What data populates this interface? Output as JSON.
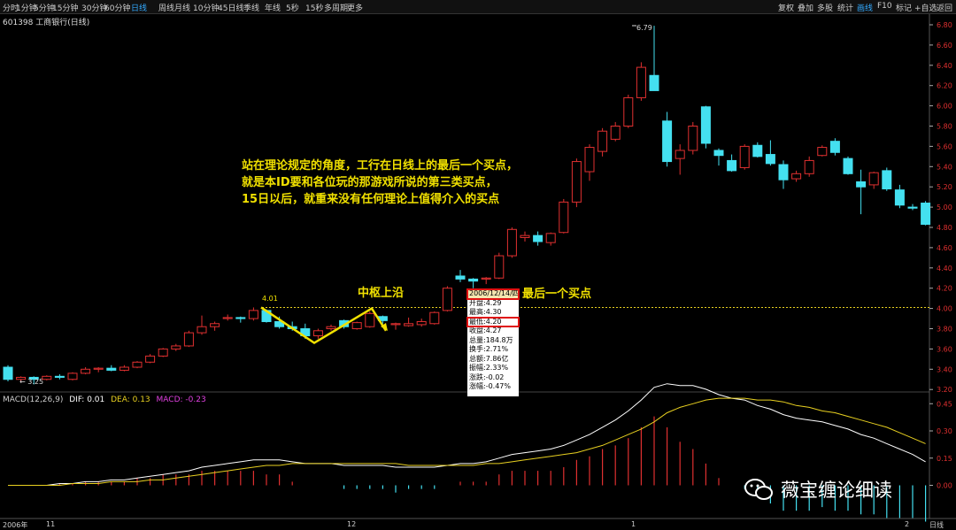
{
  "toolbar": {
    "tabs": [
      "分时",
      "1分钟",
      "5分钟",
      "15分钟",
      "30分钟",
      "60分钟",
      "日线",
      "周线",
      "月线",
      "10分钟",
      "45日线",
      "季线",
      "年线",
      "5秒",
      "15秒",
      "多周期",
      "更多"
    ],
    "active_tab": "日线",
    "right_buttons": [
      "复权",
      "叠加",
      "多股",
      "统计",
      "画线",
      "F10",
      "标记",
      "+自选",
      "返回"
    ],
    "active_right": "画线"
  },
  "stock_title": "601398 工商银行(日线)",
  "macd_header": {
    "label": "MACD(12,26,9)",
    "dif": "DIF: 0.01",
    "dea": "DEA: 0.13",
    "macd": "MACD: -0.23"
  },
  "x_labels": {
    "year": "2006年",
    "m11": "11",
    "m12": "12",
    "m1": "1",
    "m2": "2",
    "period": "日线"
  },
  "annotations": {
    "main_text": [
      "站在理论规定的角度，工行在日线上的最后一个买点，",
      "就是本ID要和各位玩的那游戏所说的第三类买点，",
      "15日以后，就重来没有任何理论上值得介入的买点"
    ],
    "center_top": "中枢上沿",
    "last_buy": "最后一个买点",
    "high_label": "6.79",
    "low_label": "3.25",
    "pivot_label": "4.01"
  },
  "tooltip": {
    "date": "2006/12/14/四",
    "rows": [
      "开盘:4.29",
      "最高:4.30",
      "最低:4.20",
      "收盘:4.27",
      "总量:184.8万",
      "换手:2.71%",
      "总额:7.86亿",
      "振幅:2.33%",
      "涨跌:-0.02",
      "涨幅:-0.47%"
    ]
  },
  "watermark": "薇宝缠论细读",
  "colors": {
    "up": "#e03030",
    "down": "#44e0f0",
    "dif": "#ffffff",
    "dea": "#e8d020",
    "accent": "#f0e000",
    "tab_active": "#3399ff"
  },
  "chart_data": [
    {
      "type": "candlestick",
      "title": "601398 工商银行(日线)",
      "y_ticks": [
        3.2,
        3.4,
        3.6,
        3.8,
        4.0,
        4.2,
        4.4,
        4.6,
        4.8,
        5.0,
        5.2,
        5.4,
        5.6,
        5.8,
        6.0,
        6.2,
        6.4,
        6.6,
        6.8
      ],
      "ylim": [
        3.17,
        6.87
      ],
      "reference_line": 4.01,
      "candles": [
        [
          3.42,
          3.44,
          3.28,
          3.3
        ],
        [
          3.3,
          3.33,
          3.27,
          3.32
        ],
        [
          3.32,
          3.33,
          3.25,
          3.3
        ],
        [
          3.3,
          3.34,
          3.29,
          3.33
        ],
        [
          3.33,
          3.35,
          3.3,
          3.32
        ],
        [
          3.3,
          3.37,
          3.29,
          3.36
        ],
        [
          3.36,
          3.42,
          3.35,
          3.4
        ],
        [
          3.4,
          3.42,
          3.37,
          3.41
        ],
        [
          3.41,
          3.44,
          3.38,
          3.39
        ],
        [
          3.39,
          3.44,
          3.38,
          3.42
        ],
        [
          3.42,
          3.48,
          3.41,
          3.47
        ],
        [
          3.47,
          3.55,
          3.46,
          3.53
        ],
        [
          3.53,
          3.61,
          3.52,
          3.6
        ],
        [
          3.6,
          3.65,
          3.58,
          3.63
        ],
        [
          3.63,
          3.78,
          3.62,
          3.76
        ],
        [
          3.76,
          3.93,
          3.74,
          3.82
        ],
        [
          3.82,
          3.87,
          3.78,
          3.85
        ],
        [
          3.9,
          3.94,
          3.88,
          3.91
        ],
        [
          3.91,
          3.92,
          3.86,
          3.9
        ],
        [
          3.9,
          4.01,
          3.88,
          3.98
        ],
        [
          3.98,
          3.99,
          3.86,
          3.87
        ],
        [
          3.87,
          3.92,
          3.8,
          3.82
        ],
        [
          3.82,
          3.87,
          3.78,
          3.8
        ],
        [
          3.8,
          3.85,
          3.7,
          3.73
        ],
        [
          3.73,
          3.8,
          3.7,
          3.78
        ],
        [
          3.8,
          3.84,
          3.78,
          3.82
        ],
        [
          3.88,
          3.89,
          3.8,
          3.82
        ],
        [
          3.8,
          3.87,
          3.79,
          3.86
        ],
        [
          3.82,
          3.97,
          3.81,
          3.95
        ],
        [
          3.92,
          3.93,
          3.85,
          3.88
        ],
        [
          3.84,
          3.86,
          3.79,
          3.85
        ],
        [
          3.83,
          3.91,
          3.82,
          3.85
        ],
        [
          3.84,
          3.9,
          3.82,
          3.87
        ],
        [
          3.85,
          3.97,
          3.84,
          3.96
        ],
        [
          3.98,
          4.22,
          3.97,
          4.2
        ],
        [
          4.32,
          4.38,
          4.26,
          4.29
        ],
        [
          4.29,
          4.3,
          4.2,
          4.27
        ],
        [
          4.29,
          4.31,
          4.24,
          4.3
        ],
        [
          4.3,
          4.55,
          4.29,
          4.52
        ],
        [
          4.52,
          4.8,
          4.5,
          4.78
        ],
        [
          4.7,
          4.76,
          4.66,
          4.72
        ],
        [
          4.72,
          4.76,
          4.62,
          4.66
        ],
        [
          4.65,
          4.75,
          4.62,
          4.74
        ],
        [
          4.75,
          5.08,
          4.74,
          5.05
        ],
        [
          5.05,
          5.48,
          5.0,
          5.45
        ],
        [
          5.35,
          5.62,
          5.26,
          5.59
        ],
        [
          5.55,
          5.78,
          5.5,
          5.75
        ],
        [
          5.67,
          5.84,
          5.65,
          5.8
        ],
        [
          5.8,
          6.11,
          5.78,
          6.08
        ],
        [
          6.08,
          6.43,
          6.05,
          6.38
        ],
        [
          6.3,
          6.79,
          6.15,
          6.15
        ],
        [
          5.85,
          5.94,
          5.4,
          5.45
        ],
        [
          5.48,
          5.62,
          5.32,
          5.56
        ],
        [
          5.56,
          5.84,
          5.52,
          5.8
        ],
        [
          5.99,
          6.0,
          5.58,
          5.63
        ],
        [
          5.56,
          5.58,
          5.41,
          5.51
        ],
        [
          5.46,
          5.52,
          5.35,
          5.36
        ],
        [
          5.39,
          5.62,
          5.37,
          5.6
        ],
        [
          5.61,
          5.64,
          5.49,
          5.5
        ],
        [
          5.52,
          5.66,
          5.41,
          5.43
        ],
        [
          5.42,
          5.46,
          5.18,
          5.27
        ],
        [
          5.28,
          5.36,
          5.25,
          5.33
        ],
        [
          5.33,
          5.5,
          5.3,
          5.46
        ],
        [
          5.51,
          5.61,
          5.5,
          5.59
        ],
        [
          5.65,
          5.68,
          5.51,
          5.54
        ],
        [
          5.48,
          5.5,
          5.32,
          5.33
        ],
        [
          5.25,
          5.37,
          4.93,
          5.2
        ],
        [
          5.22,
          5.35,
          5.18,
          5.34
        ],
        [
          5.36,
          5.39,
          5.16,
          5.18
        ],
        [
          5.17,
          5.22,
          4.99,
          5.02
        ],
        [
          5.0,
          5.03,
          4.97,
          4.99
        ],
        [
          5.04,
          5.06,
          4.82,
          4.83
        ]
      ]
    },
    {
      "type": "macd",
      "y_ticks": [
        0.0,
        0.15,
        0.3,
        0.45
      ],
      "ylim": [
        -0.2,
        0.64
      ],
      "series": [
        {
          "name": "DIF",
          "values": [
            0.0,
            0.0,
            0.0,
            0.0,
            0.01,
            0.01,
            0.02,
            0.02,
            0.03,
            0.03,
            0.04,
            0.05,
            0.06,
            0.07,
            0.08,
            0.1,
            0.11,
            0.12,
            0.13,
            0.14,
            0.14,
            0.14,
            0.13,
            0.12,
            0.12,
            0.12,
            0.11,
            0.11,
            0.11,
            0.11,
            0.1,
            0.1,
            0.1,
            0.1,
            0.11,
            0.12,
            0.12,
            0.13,
            0.15,
            0.17,
            0.18,
            0.19,
            0.2,
            0.22,
            0.25,
            0.28,
            0.32,
            0.36,
            0.41,
            0.47,
            0.54,
            0.56,
            0.55,
            0.55,
            0.53,
            0.5,
            0.48,
            0.47,
            0.44,
            0.42,
            0.39,
            0.37,
            0.36,
            0.35,
            0.33,
            0.31,
            0.28,
            0.26,
            0.23,
            0.2,
            0.17,
            0.13
          ]
        },
        {
          "name": "DEA",
          "values": [
            0.0,
            0.0,
            0.0,
            0.0,
            0.0,
            0.01,
            0.01,
            0.01,
            0.02,
            0.02,
            0.02,
            0.03,
            0.03,
            0.04,
            0.05,
            0.06,
            0.07,
            0.08,
            0.09,
            0.1,
            0.11,
            0.11,
            0.12,
            0.12,
            0.12,
            0.12,
            0.12,
            0.12,
            0.12,
            0.12,
            0.12,
            0.11,
            0.11,
            0.11,
            0.11,
            0.11,
            0.11,
            0.12,
            0.12,
            0.13,
            0.14,
            0.15,
            0.16,
            0.17,
            0.18,
            0.2,
            0.22,
            0.25,
            0.28,
            0.31,
            0.35,
            0.4,
            0.43,
            0.45,
            0.47,
            0.48,
            0.48,
            0.48,
            0.47,
            0.47,
            0.46,
            0.44,
            0.43,
            0.41,
            0.4,
            0.38,
            0.36,
            0.34,
            0.32,
            0.29,
            0.26,
            0.23
          ]
        },
        {
          "name": "MACD",
          "values": [
            0.0,
            0.0,
            0.0,
            0.0,
            0.01,
            0.01,
            0.02,
            0.02,
            0.02,
            0.02,
            0.04,
            0.04,
            0.06,
            0.06,
            0.06,
            0.08,
            0.08,
            0.08,
            0.08,
            0.08,
            0.06,
            0.06,
            0.02,
            0.0,
            0.0,
            0.0,
            -0.02,
            -0.02,
            -0.02,
            -0.02,
            -0.04,
            -0.02,
            -0.02,
            -0.02,
            0.0,
            0.02,
            0.02,
            0.02,
            0.06,
            0.08,
            0.08,
            0.08,
            0.08,
            0.1,
            0.14,
            0.16,
            0.2,
            0.22,
            0.26,
            0.32,
            0.38,
            0.32,
            0.24,
            0.2,
            0.12,
            0.04,
            0.0,
            -0.02,
            -0.06,
            -0.1,
            -0.14,
            -0.14,
            -0.14,
            -0.12,
            -0.14,
            -0.14,
            -0.16,
            -0.16,
            -0.18,
            -0.18,
            -0.18,
            -0.2
          ]
        }
      ]
    }
  ]
}
